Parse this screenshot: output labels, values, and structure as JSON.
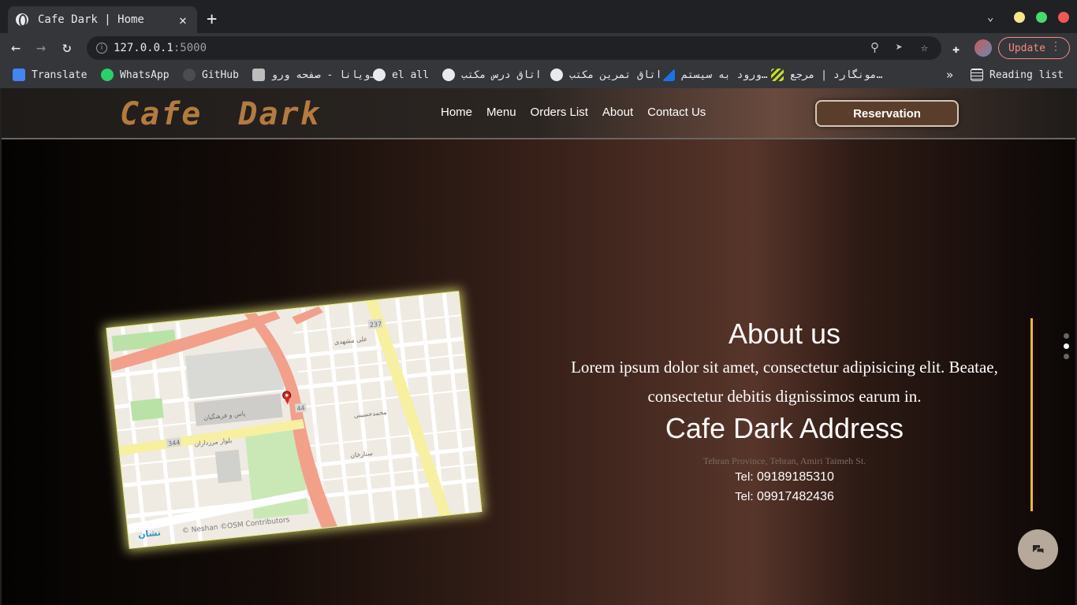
{
  "browser": {
    "tab_title": "Cafe Dark | Home",
    "tab_close": "✕",
    "new_tab": "+",
    "url_host": "127.0.0.1",
    "url_port": ":5000",
    "update_label": "Update",
    "bookmarks": [
      {
        "label": "Translate",
        "icon": "google-translate-icon",
        "color": "#4285f4"
      },
      {
        "label": "WhatsApp",
        "icon": "whatsapp-icon",
        "color": "#25d366"
      },
      {
        "label": "GitHub",
        "icon": "github-icon",
        "color": "#e8eaed"
      },
      {
        "label": "ویانا - صفحه ورو…",
        "icon": "page-icon",
        "color": "#bdbdbd"
      },
      {
        "label": "el all",
        "icon": "account-icon",
        "color": "#e8eaed"
      },
      {
        "label": "اتاق درس مکتب",
        "icon": "account-icon",
        "color": "#e8eaed"
      },
      {
        "label": "اتاق تمرین مکتب",
        "icon": "account-icon",
        "color": "#e8eaed"
      },
      {
        "label": "ورود به سیستم…",
        "icon": "triangle-icon",
        "color": "#1a73e8"
      },
      {
        "label": "مونگارد | مرجع…",
        "icon": "stripes-icon",
        "color": "#c6e01a"
      }
    ],
    "reading_list": "Reading list"
  },
  "site": {
    "logo": "Cafe Dark",
    "nav": [
      "Home",
      "Menu",
      "Orders List",
      "About",
      "Contact Us"
    ],
    "reservation": "Reservation"
  },
  "about": {
    "title": "About us",
    "text": "Lorem ipsum dolor sit amet, consectetur adipisicing elit. Beatae, consectetur debitis dignissimos earum in.",
    "address_title": "Cafe Dark Address",
    "address": "Tehran Province, Tehran, Amiri Taimeh St.",
    "tel_label": "Tel:",
    "phones": [
      "09189185310",
      "09917482436"
    ]
  },
  "map": {
    "attribution": "© Neshan ©OSM Contributors",
    "brand": "نشان",
    "street_labels": [
      "بلوار مرزداران",
      "پاس و فرهنگیان",
      "ستارخان",
      "علی مشهدی",
      "محمدحسینی"
    ],
    "road_numbers": [
      "237",
      "44",
      "344"
    ]
  }
}
